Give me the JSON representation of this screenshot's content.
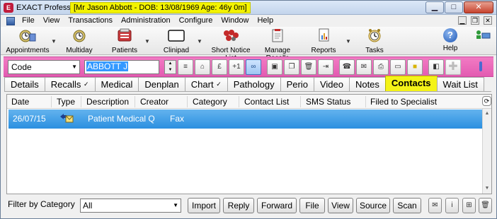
{
  "window": {
    "app_title": "EXACT Professional",
    "patient_banner": "[Mr Jason Abbott - DOB: 13/08/1969 Age: 46y 0m]",
    "buttons": {
      "minimize": "▁",
      "maximize": "□",
      "close": "✕"
    }
  },
  "menu": {
    "items": [
      "File",
      "View",
      "Transactions",
      "Administration",
      "Configure",
      "Window",
      "Help"
    ]
  },
  "toolbar": {
    "items": [
      {
        "label": "Appointments",
        "icon": "appointments-icon",
        "dropdown": true
      },
      {
        "label": "Multiday",
        "icon": "multiday-icon",
        "dropdown": false
      },
      {
        "label": "Patients",
        "icon": "patients-icon",
        "dropdown": true
      },
      {
        "label": "Clinipad",
        "icon": "clinipad-icon",
        "dropdown": true
      },
      {
        "label": "Short Notice List",
        "icon": "short-notice-icon",
        "dropdown": false
      },
      {
        "label": "Manage Recalls",
        "icon": "recalls-icon",
        "dropdown": false
      },
      {
        "label": "Reports",
        "icon": "reports-icon",
        "dropdown": true
      },
      {
        "label": "Tasks",
        "icon": "tasks-icon",
        "dropdown": false
      },
      {
        "label": "Help",
        "icon": "help-icon",
        "dropdown": false
      }
    ]
  },
  "search": {
    "field_selector": "Code",
    "value": "ABBOTT J"
  },
  "tabs": [
    {
      "label": "Details",
      "active": false
    },
    {
      "label": "Recalls",
      "active": false,
      "check": "✓"
    },
    {
      "label": "Medical",
      "active": false
    },
    {
      "label": "Denplan",
      "active": false
    },
    {
      "label": "Chart",
      "active": false,
      "check": "✓"
    },
    {
      "label": "Pathology",
      "active": false
    },
    {
      "label": "Perio",
      "active": false
    },
    {
      "label": "Video",
      "active": false
    },
    {
      "label": "Notes",
      "active": false
    },
    {
      "label": "Contacts",
      "active": true
    },
    {
      "label": "Wait List",
      "active": false
    }
  ],
  "contacts_table": {
    "columns": [
      "Date",
      "Type",
      "Description",
      "Creator",
      "Category",
      "Contact List",
      "SMS Status",
      "Filed to Specialist"
    ],
    "rows": [
      {
        "date": "26/07/15",
        "type_icon": "letter-icon",
        "description": "Patient Medical Q",
        "creator": "Fax",
        "category": "",
        "contact_list": "",
        "sms_status": "",
        "filed": ""
      }
    ]
  },
  "footer": {
    "filter_label": "Filter by Category",
    "filter_value": "All",
    "buttons": [
      "Import",
      "Reply",
      "Forward",
      "File",
      "View",
      "Source",
      "Scan"
    ]
  },
  "colors": {
    "pink_bar": "#e35bb1",
    "selected_row": "#2b8fe0",
    "active_tab": "#f4f318",
    "patient_banner": "#f3f300"
  }
}
